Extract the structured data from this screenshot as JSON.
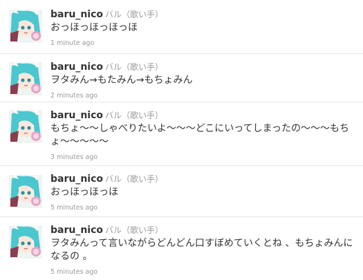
{
  "tweets": [
    {
      "screen_name": "baru_nico",
      "full_name": "バル（歌い手）",
      "text": "おっほっほっほっほ",
      "time": "1 minute ago"
    },
    {
      "screen_name": "baru_nico",
      "full_name": "バル（歌い手）",
      "text": "ヲタみん→もたみん→もちょみん",
      "time": "2 minutes ago"
    },
    {
      "screen_name": "baru_nico",
      "full_name": "バル（歌い手）",
      "text": "もちょ～～しゃべりたいよ～～～どこにいってしまったの～～～もちょ～～～～～",
      "time": "3 minutes ago"
    },
    {
      "screen_name": "baru_nico",
      "full_name": "バル（歌い手）",
      "text": "おっほっほっほ",
      "time": "5 minutes ago"
    },
    {
      "screen_name": "baru_nico",
      "full_name": "バル（歌い手）",
      "text": "ヲタみんって言いながらどんどん口すぼめていくとね 、もちょみんになるの 。",
      "time": "5 minutes ago"
    }
  ],
  "colors": {
    "text": "#333333",
    "meta": "#999999",
    "divider": "#e6e6e6",
    "avatar_hair": "#4cc6cf"
  },
  "icons": {
    "avatar": "anime-character-avatar"
  }
}
